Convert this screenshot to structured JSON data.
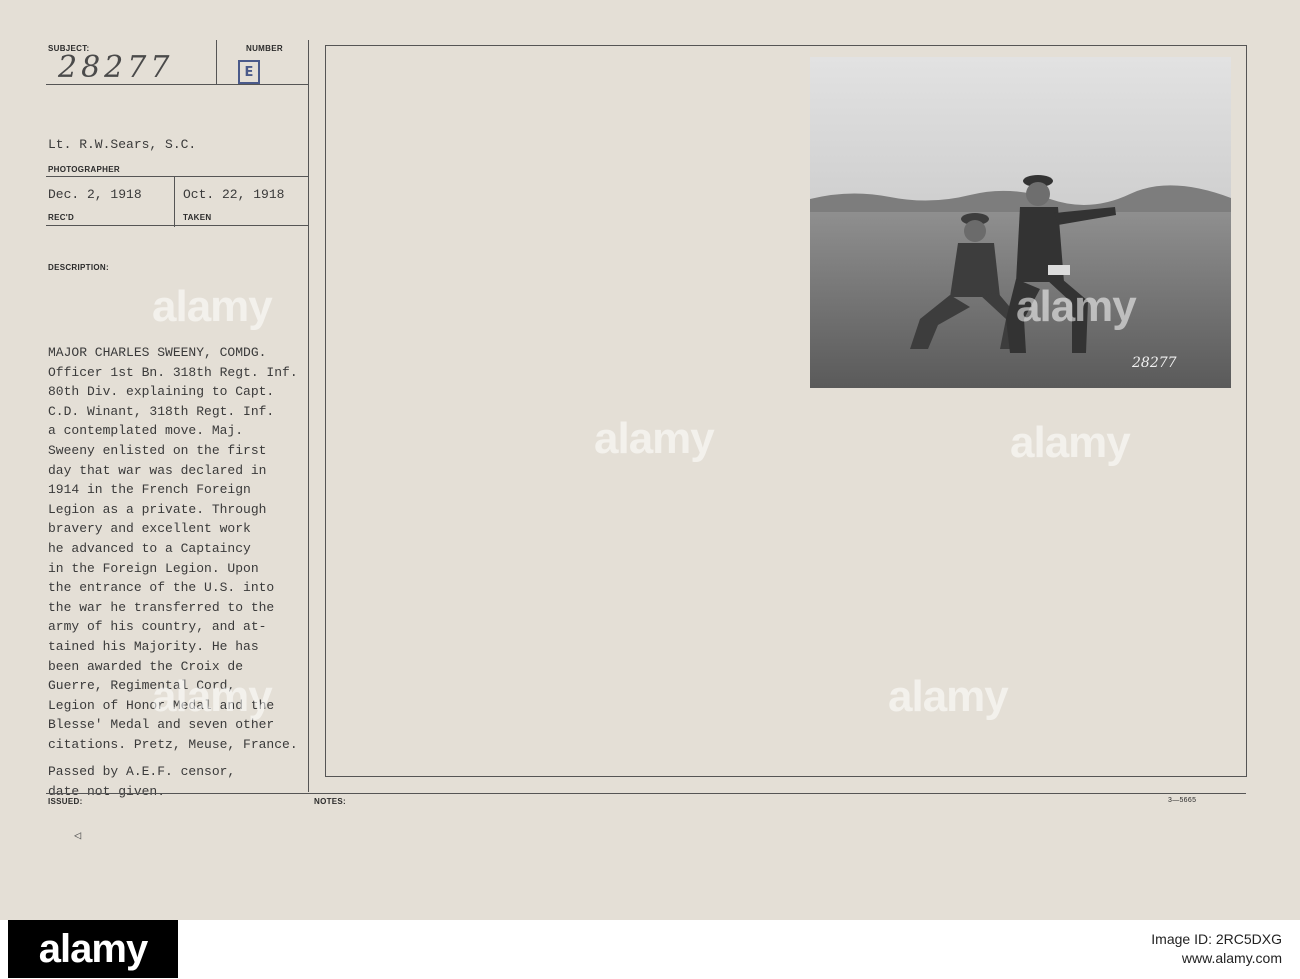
{
  "card": {
    "subject_label": "SUBJECT:",
    "subject_value": "28277",
    "number_label": "NUMBER",
    "number_stamp": "E",
    "photographer_value": "Lt. R.W.Sears, S.C.",
    "photographer_label": "PHOTOGRAPHER",
    "recd_value": "Dec. 2, 1918",
    "recd_label": "REC'D",
    "taken_value": "Oct. 22, 1918",
    "taken_label": "TAKEN",
    "description_label": "DESCRIPTION:",
    "description_lines": [
      "MAJOR CHARLES SWEENY, COMDG.",
      "Officer 1st Bn. 318th Regt. Inf.",
      "80th Div. explaining to Capt.",
      "C.D. Winant, 318th Regt. Inf.",
      "a contemplated move. Maj.",
      "Sweeny enlisted on the first",
      "day that war was declared in",
      "1914 in the French Foreign",
      "Legion as a private. Through",
      "bravery and excellent work",
      "he advanced to a Captaincy",
      "in the Foreign Legion. Upon",
      "the entrance of the U.S. into",
      "the war he transferred to the",
      "army of his country, and at-",
      "tained his Majority. He has",
      "been awarded the Croix de",
      "Guerre, Regimental Cord,",
      "Legion of Honor Medal and the",
      "Blesse' Medal and seven other",
      "citations. Pretz, Meuse, France."
    ],
    "censor_lines": [
      "Passed by A.E.F. censor,",
      "date not given."
    ],
    "issued_label": "ISSUED:",
    "notes_label": "NOTES:",
    "form_number": "3—5665",
    "photo_caption": "28277"
  },
  "watermarks": [
    "alamy",
    "alamy",
    "alamy",
    "alamy",
    "alamy",
    "alamy"
  ],
  "footer": {
    "logo": "alamy",
    "image_id_label": "Image ID: 2RC5DXG",
    "url": "www.alamy.com"
  },
  "colors": {
    "card_bg": "#e4dfd6",
    "ink": "#3a3a3a",
    "stamp_blue": "#4a5a8a"
  }
}
